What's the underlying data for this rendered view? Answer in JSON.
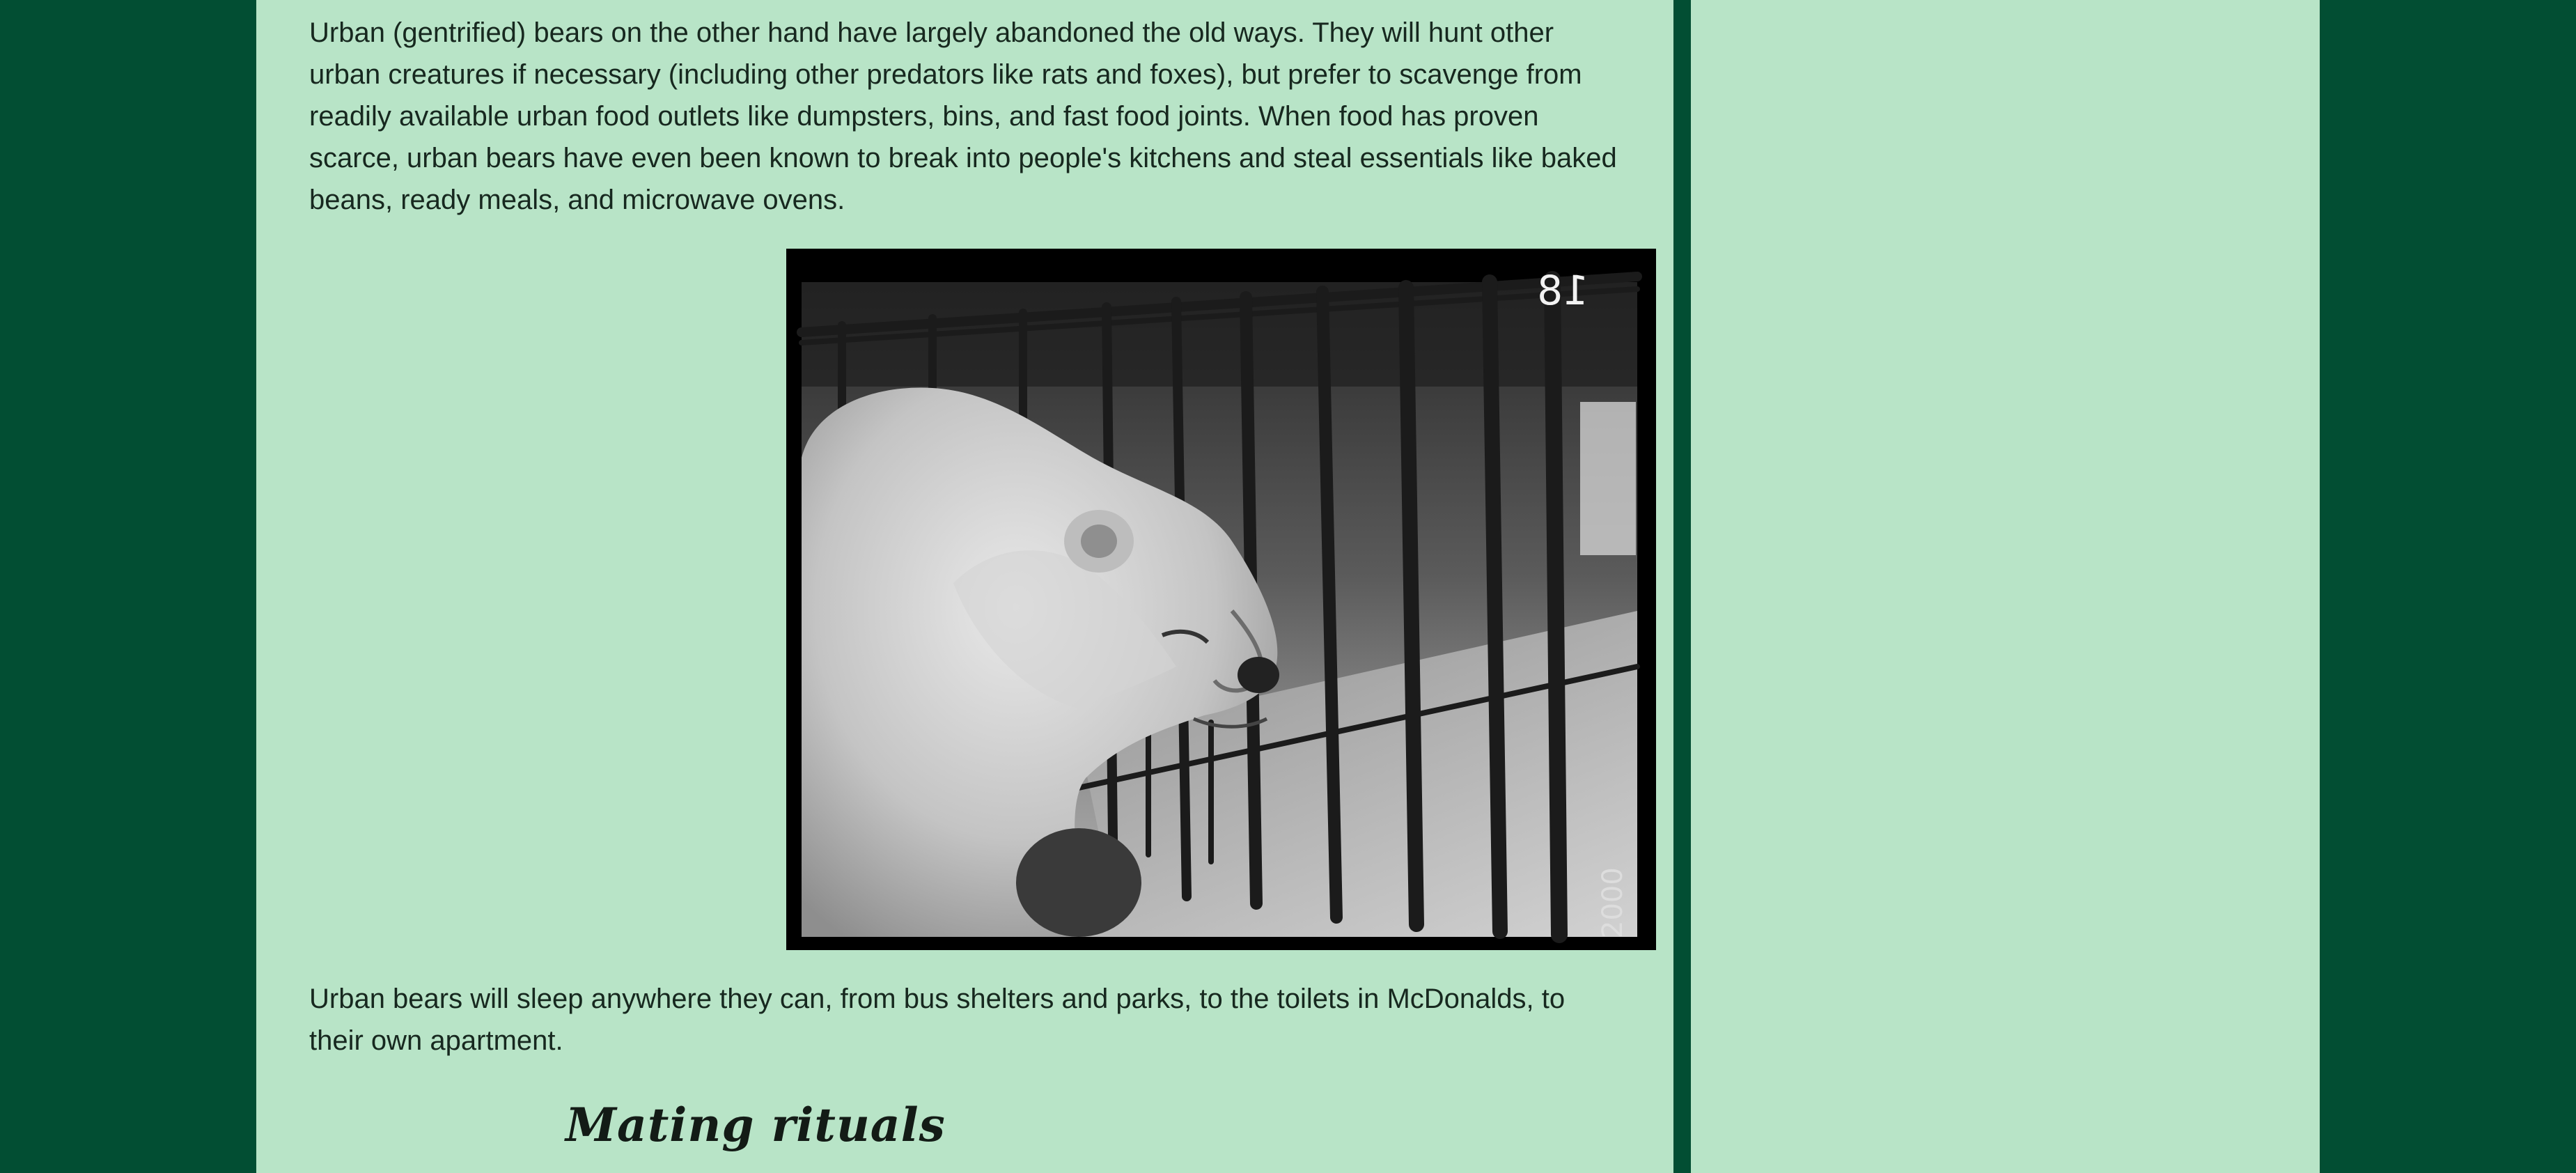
{
  "article": {
    "paragraph_1": "Urban (gentrified) bears on the other hand have largely abandoned the old ways. They will hunt other urban creatures if necessary (including other predators like rats and foxes), but prefer to scavenge from readily available urban food outlets like dumpsters, bins, and fast food joints. When food has proven scarce, urban bears have even been known to break into people's kitchens and steal essentials like baked beans, ready meals, and microwave ovens.",
    "photo_corner_number": "18",
    "photo_edge_marking": "2000",
    "paragraph_2": "Urban bears will sleep anywhere they can, from bus shelters and parks, to the toilets in McDonalds, to their own apartment.",
    "section_heading": "Mating rituals"
  },
  "colors": {
    "page_background": "#024e33",
    "column_background": "#b8e4c7",
    "text": "#17281f"
  }
}
